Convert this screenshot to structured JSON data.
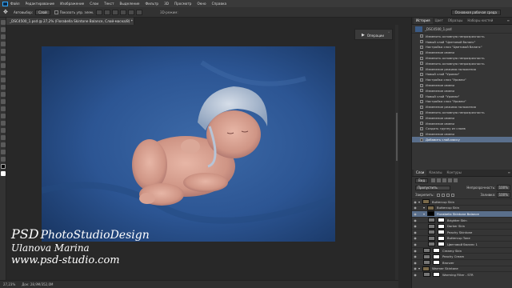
{
  "menu": {
    "items": [
      "Файл",
      "Редактирование",
      "Изображение",
      "Слои",
      "Текст",
      "Выделение",
      "Фильтр",
      "3D",
      "Просмотр",
      "Окно",
      "Справка"
    ]
  },
  "options": {
    "autoselect_label": "Автовыбор:",
    "autoselect_value": "Слой",
    "show_controls_label": "Показать упр. элем.",
    "mode3d_label": "3D-режим:",
    "workspace": "Основная рабочая среда"
  },
  "document": {
    "tab_title": "_DSC4500_1.psd @ 27,2% (Florabella Skintone Balance, Слой-маска/8) *",
    "zoom": "27,23%",
    "doc_size": "Док: 28,9M/352,0M"
  },
  "watermark": {
    "psd": "PSD",
    "studio": "PhotoStudioDesign",
    "author": "Ulanova Marina",
    "url": "www.psd-studio.com"
  },
  "actions_dock": {
    "button_label": "Операции"
  },
  "panels": {
    "top_tabs": [
      "История",
      "Цвет",
      "Образцы",
      "Наборы кистей"
    ],
    "history_snapshot": "_DSC4500_1.psd",
    "history_items": [
      "Изменить основную непрозрачность",
      "Новый слой \"Цветовой баланс\"",
      "Настройка слоя \"Цветовой баланс\"",
      "Изменение имени",
      "Изменить основную непрозрачность",
      "Изменить основную непрозрачность",
      "Изменение режима наложения",
      "Новый слой \"Уровни\"",
      "Настройка слоя \"Уровни\"",
      "Изменение имени",
      "Изменение имени",
      "Новый слой \"Уровни\"",
      "Настройка слоя \"Уровни\"",
      "Изменение режима наложения",
      "Изменить основную непрозрачность",
      "Изменение имени",
      "Изменение имени",
      "Создать группу из слоев",
      "Изменение имени",
      "Добавить слой-маску"
    ],
    "history_active_index": 19,
    "layer_tabs": [
      "Слои",
      "Каналы",
      "Контуры"
    ],
    "kind_label": "Вид",
    "blend_mode": "Пропустить",
    "opacity_label": "Непрозрачность:",
    "opacity_value": "100%",
    "lock_label": "Закрепить:",
    "fill_label": "Заливка:",
    "fill_value": "100%",
    "layers": [
      {
        "name": "Buttercup Skin",
        "type": "group",
        "indent": 0
      },
      {
        "name": "Buttercup Skin",
        "type": "group",
        "indent": 1
      },
      {
        "name": "Florabella Skintone Balance",
        "type": "group",
        "indent": 1,
        "selected": true
      },
      {
        "name": "Brighter Skin",
        "type": "adjustment",
        "indent": 2
      },
      {
        "name": "Darker Skin",
        "type": "adjustment",
        "indent": 2
      },
      {
        "name": "Peachy Skintone",
        "type": "adjustment",
        "indent": 2
      },
      {
        "name": "Buttercup Tone",
        "type": "adjustment",
        "indent": 2
      },
      {
        "name": "Цветовой баланс 1",
        "type": "adjustment",
        "indent": 2
      },
      {
        "name": "Creamy Skin",
        "type": "adjustment",
        "indent": 1
      },
      {
        "name": "Peachy Cream",
        "type": "adjustment",
        "indent": 1
      },
      {
        "name": "Bronzer",
        "type": "adjustment",
        "indent": 1
      },
      {
        "name": "Warmer Skintone",
        "type": "group",
        "indent": 0
      },
      {
        "name": "Warming Filter - STR",
        "type": "adjustment",
        "indent": 1
      }
    ]
  }
}
